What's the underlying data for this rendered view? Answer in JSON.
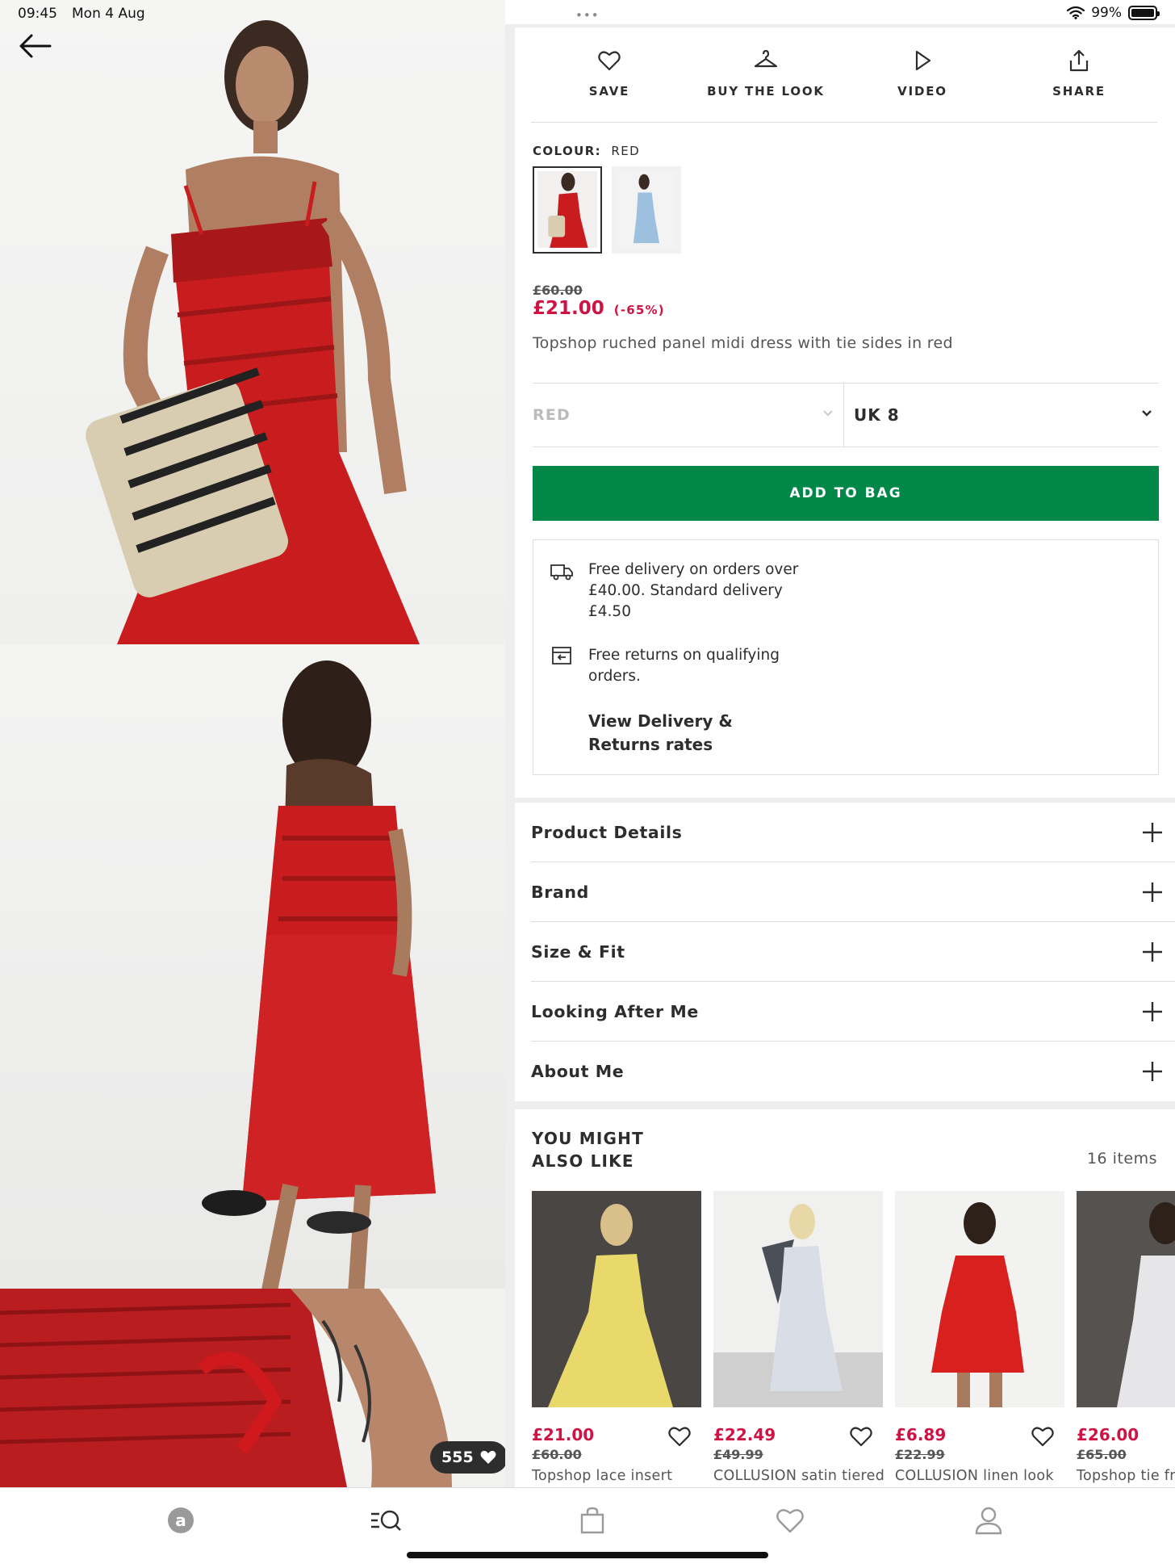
{
  "status_bar": {
    "time": "09:45",
    "date": "Mon 4 Aug",
    "battery": "99%",
    "multitask_dots": "•••"
  },
  "gallery": {
    "likes_count": "555"
  },
  "actions": [
    {
      "label": "SAVE",
      "icon": "heart-icon"
    },
    {
      "label": "BUY THE LOOK",
      "icon": "hanger-icon"
    },
    {
      "label": "VIDEO",
      "icon": "play-icon"
    },
    {
      "label": "SHARE",
      "icon": "share-icon"
    }
  ],
  "colour": {
    "label": "COLOUR:",
    "value": "RED"
  },
  "price": {
    "was": "£60.00",
    "now": "£21.00",
    "discount": "(-65%)"
  },
  "product_name": "Topshop ruched panel midi dress with tie sides in red",
  "selectors": {
    "colour": "RED",
    "size": "UK 8"
  },
  "add_to_bag": "ADD TO BAG",
  "delivery": {
    "free_delivery": "Free delivery on orders over £40.00. Standard delivery £4.50",
    "free_returns": "Free returns on qualifying orders.",
    "link": "View Delivery & Returns rates"
  },
  "accordion": [
    "Product Details",
    "Brand",
    "Size & Fit",
    "Looking After Me",
    "About Me"
  ],
  "recommendations": {
    "title": "YOU MIGHT ALSO LIKE",
    "count": "16 items",
    "items": [
      {
        "price": "£21.00",
        "was": "£60.00",
        "name": "Topshop lace insert"
      },
      {
        "price": "£22.49",
        "was": "£49.99",
        "name": "COLLUSION satin tiered"
      },
      {
        "price": "£6.89",
        "was": "£22.99",
        "name": "COLLUSION linen look"
      },
      {
        "price": "£26.00",
        "was": "£65.00",
        "name": "Topshop tie fro"
      }
    ]
  },
  "tabbar": [
    "asos-home-icon",
    "search-icon",
    "bag-icon",
    "saved-heart-icon",
    "account-icon"
  ],
  "colors": {
    "sale_red": "#d01345",
    "add_to_bag_green": "#018849",
    "text": "#2d2d2d"
  }
}
